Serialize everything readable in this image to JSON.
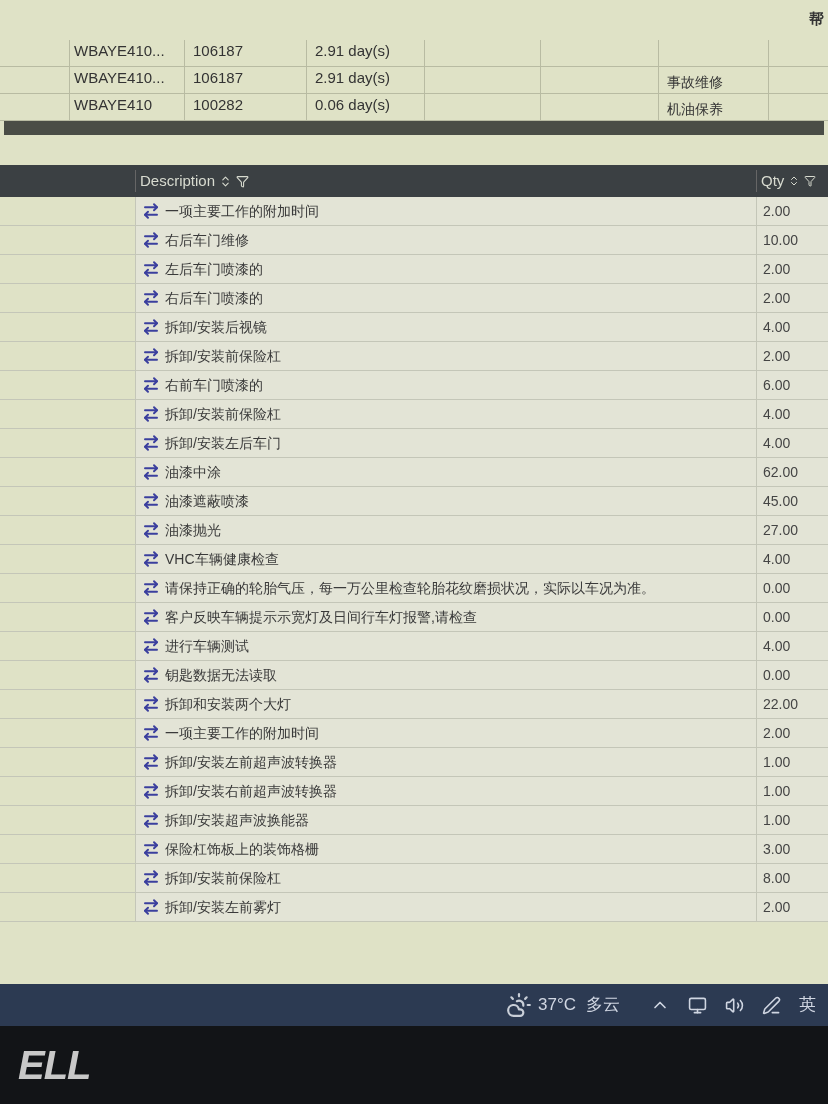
{
  "top_table": {
    "corner_text": "帮",
    "rows": [
      {
        "vin": "WBAYE410...",
        "number": "106187",
        "duration": "2.91 day(s)",
        "type": ""
      },
      {
        "vin": "WBAYE410...",
        "number": "106187",
        "duration": "2.91 day(s)",
        "type": "事故维修"
      },
      {
        "vin": "WBAYE410",
        "number": "100282",
        "duration": "0.06 day(s)",
        "type": "机油保养"
      }
    ]
  },
  "grid": {
    "columns": [
      {
        "label": "Description"
      },
      {
        "label": "Qty"
      }
    ],
    "rows": [
      {
        "description": "一项主要工作的附加时间",
        "qty": "2.00"
      },
      {
        "description": "右后车门维修",
        "qty": "10.00"
      },
      {
        "description": "左后车门喷漆的",
        "qty": "2.00"
      },
      {
        "description": "右后车门喷漆的",
        "qty": "2.00"
      },
      {
        "description": "拆卸/安装后视镜",
        "qty": "4.00"
      },
      {
        "description": "拆卸/安装前保险杠",
        "qty": "2.00"
      },
      {
        "description": "右前车门喷漆的",
        "qty": "6.00"
      },
      {
        "description": "拆卸/安装前保险杠",
        "qty": "4.00"
      },
      {
        "description": "拆卸/安装左后车门",
        "qty": "4.00"
      },
      {
        "description": "油漆中涂",
        "qty": "62.00"
      },
      {
        "description": "油漆遮蔽喷漆",
        "qty": "45.00"
      },
      {
        "description": "油漆抛光",
        "qty": "27.00"
      },
      {
        "description": "VHC车辆健康检查",
        "qty": "4.00"
      },
      {
        "description": "请保持正确的轮胎气压，每一万公里检查轮胎花纹磨损状况，实际以车况为准。",
        "qty": "0.00"
      },
      {
        "description": "客户反映车辆提示示宽灯及日间行车灯报警,请检查",
        "qty": "0.00"
      },
      {
        "description": "进行车辆测试",
        "qty": "4.00"
      },
      {
        "description": "钥匙数据无法读取",
        "qty": "0.00"
      },
      {
        "description": "拆卸和安装两个大灯",
        "qty": "22.00"
      },
      {
        "description": "一项主要工作的附加时间",
        "qty": "2.00"
      },
      {
        "description": "拆卸/安装左前超声波转换器",
        "qty": "1.00"
      },
      {
        "description": "拆卸/安装右前超声波转换器",
        "qty": "1.00"
      },
      {
        "description": "拆卸/安装超声波换能器",
        "qty": "1.00"
      },
      {
        "description": "保险杠饰板上的装饰格栅",
        "qty": "3.00"
      },
      {
        "description": "拆卸/安装前保险杠",
        "qty": "8.00"
      },
      {
        "description": "拆卸/安装左前雾灯",
        "qty": "2.00"
      }
    ]
  },
  "taskbar": {
    "temperature": "37°C",
    "weather": "多云",
    "input_method": "英"
  },
  "bezel": {
    "logo": "ELL"
  }
}
